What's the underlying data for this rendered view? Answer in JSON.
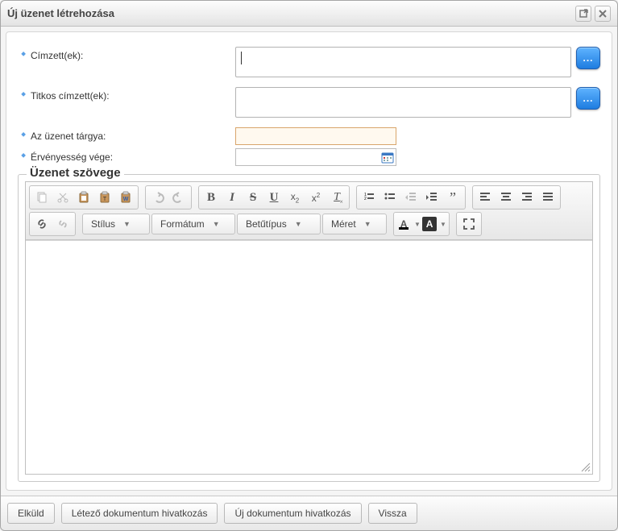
{
  "window": {
    "title": "Új üzenet létrehozása"
  },
  "labels": {
    "recipients": "Címzett(ek):",
    "bcc": "Titkos címzett(ek):",
    "subject": "Az üzenet tárgya:",
    "validity": "Érvényesség vége:"
  },
  "fields": {
    "recipients": "",
    "bcc": "",
    "subject": "",
    "validity": ""
  },
  "ellipsis": "...",
  "fieldset": {
    "legend": "Üzenet szövege"
  },
  "toolbar": {
    "combos": {
      "style": "Stílus",
      "format": "Formátum",
      "font": "Betűtípus",
      "size": "Méret"
    }
  },
  "footer": {
    "send": "Elküld",
    "existing_doc": "Létező dokumentum hivatkozás",
    "new_doc": "Új dokumentum hivatkozás",
    "back": "Vissza"
  }
}
